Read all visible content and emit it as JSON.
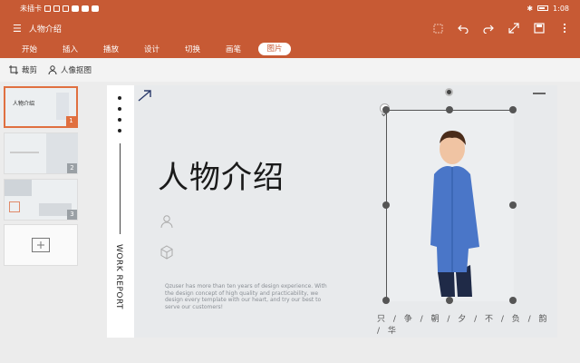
{
  "status": {
    "carrier": "未插卡",
    "time": "1:08"
  },
  "title": {
    "menu": "☰",
    "doc_name": "人物介绍"
  },
  "toolbar_icons": [
    "window-icon",
    "undo-icon",
    "redo-icon",
    "expand-icon",
    "save-icon",
    "more-icon"
  ],
  "tabs": [
    "开始",
    "插入",
    "播放",
    "设计",
    "切换",
    "画笔",
    "图片"
  ],
  "active_tab_index": 6,
  "subtools": {
    "crop": "裁剪",
    "portrait_cutout": "人像抠图"
  },
  "thumbnails": [
    "1",
    "2",
    "3"
  ],
  "slide": {
    "title": "人物介绍",
    "side_text": "WORK REPORT",
    "description": "Qzuser has more than ten years of design experience. With the design concept of high quality and practicability, we design every template with our heart, and try our best to serve our customers!",
    "footer": "只 / 争 / 朝 / 夕 / 不 / 负 / 韵 / 华"
  },
  "colors": {
    "accent": "#c75a34",
    "selection": "#e07040"
  }
}
